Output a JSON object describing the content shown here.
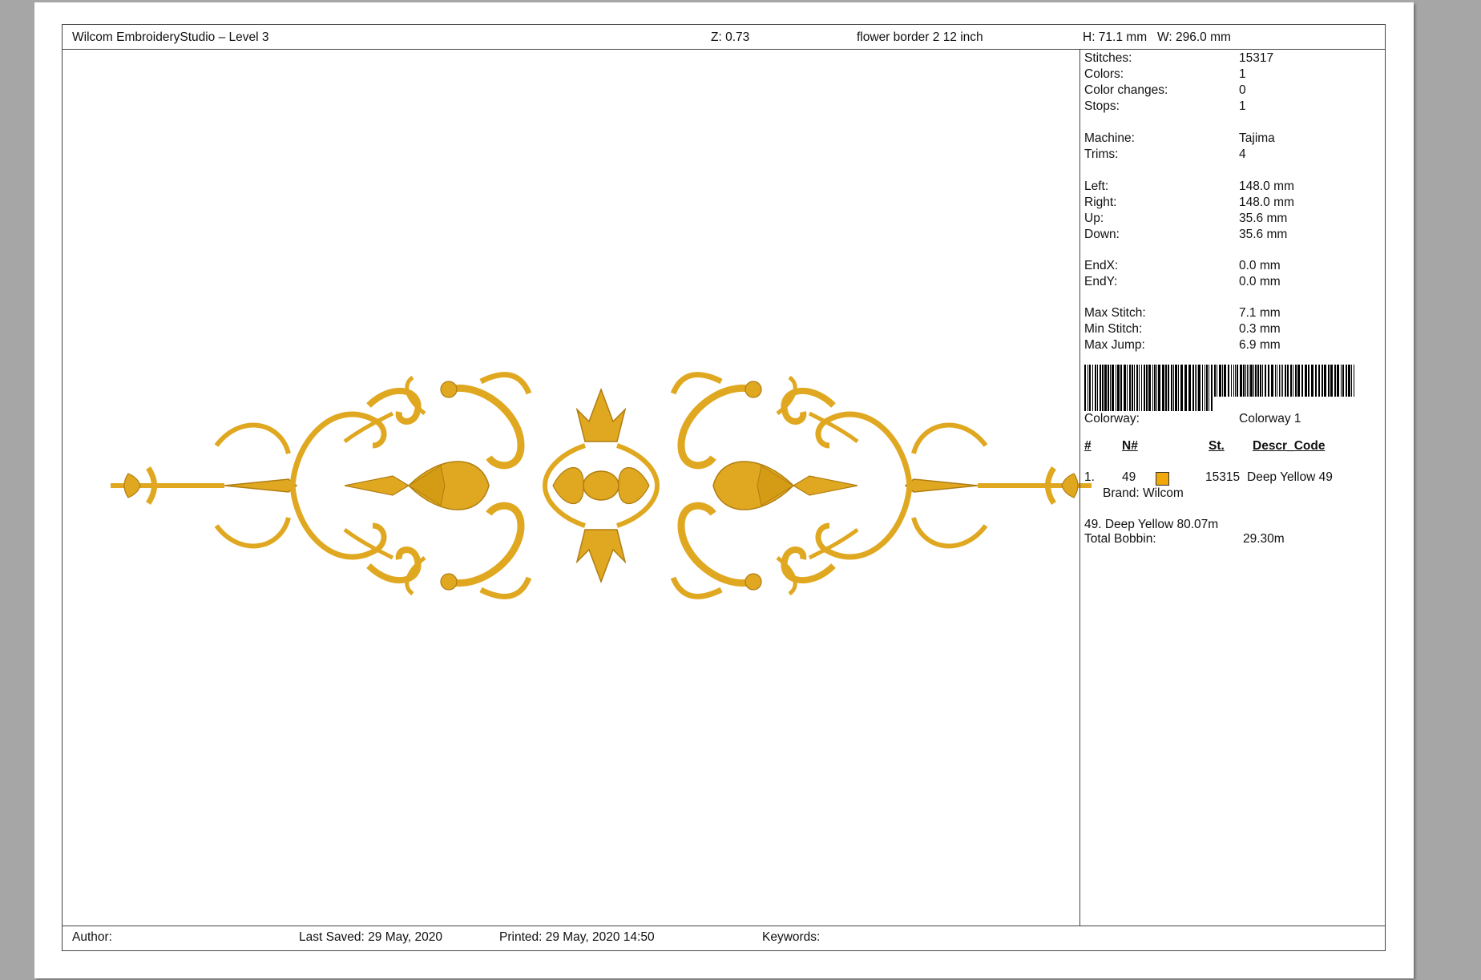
{
  "header": {
    "app_title": "Wilcom EmbroideryStudio – Level 3",
    "zoom": "Z: 0.73",
    "design_name": "flower border 2 12 inch",
    "dimensions": "H: 71.1 mm   W: 296.0 mm"
  },
  "stats": {
    "stitches": {
      "label": "Stitches:",
      "value": "15317"
    },
    "colors": {
      "label": "Colors:",
      "value": "1"
    },
    "color_changes": {
      "label": "Color changes:",
      "value": "0"
    },
    "stops": {
      "label": "Stops:",
      "value": "1"
    },
    "machine": {
      "label": "Machine:",
      "value": "Tajima"
    },
    "trims": {
      "label": "Trims:",
      "value": "4"
    },
    "left": {
      "label": "Left:",
      "value": "148.0 mm"
    },
    "right": {
      "label": "Right:",
      "value": "148.0 mm"
    },
    "up": {
      "label": "Up:",
      "value": "35.6 mm"
    },
    "down": {
      "label": "Down:",
      "value": "35.6 mm"
    },
    "endx": {
      "label": "EndX:",
      "value": "0.0 mm"
    },
    "endy": {
      "label": "EndY:",
      "value": "0.0 mm"
    },
    "max_stitch": {
      "label": "Max Stitch:",
      "value": "7.1 mm"
    },
    "min_stitch": {
      "label": "Min Stitch:",
      "value": "0.3 mm"
    },
    "max_jump": {
      "label": "Max Jump:",
      "value": "6.9 mm"
    }
  },
  "colorway": {
    "label": "Colorway:",
    "value": "Colorway 1"
  },
  "color_table": {
    "headers": {
      "num": "#",
      "needle": "N#",
      "stitches": "St.",
      "descr": "Descr_Code"
    },
    "rows": [
      {
        "num": "1.",
        "needle": "49",
        "color": "#f0a80c",
        "stitches": "15315",
        "descr": "Deep Yellow 49",
        "brand": "Brand: Wilcom"
      }
    ]
  },
  "thread_usage": "49. Deep Yellow 80.07m",
  "bobbin": {
    "label": "Total Bobbin:",
    "value": "29.30m"
  },
  "footer": {
    "author": "Author:",
    "last_saved": "Last Saved: 29 May, 2020",
    "printed": "Printed: 29 May, 2020 14:50",
    "keywords": "Keywords:"
  },
  "colors": {
    "thread": "#e0a820",
    "thread_dark": "#b07d10",
    "page": "#ffffff",
    "background": "#a6a6a6"
  }
}
